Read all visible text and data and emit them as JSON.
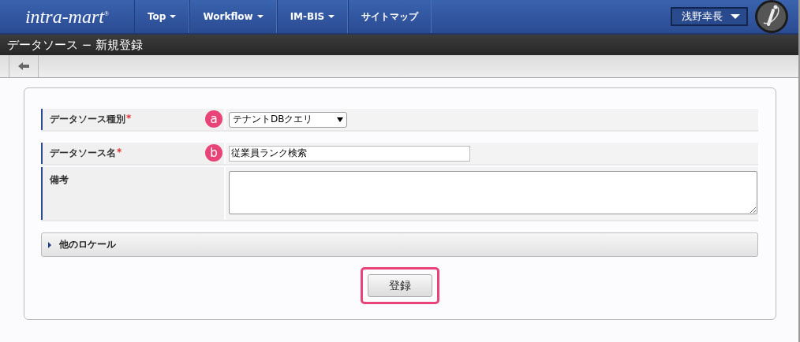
{
  "header": {
    "logo": {
      "text": "intra-mart",
      "mark": "®"
    },
    "menu": [
      {
        "label": "Top",
        "dropdown": true
      },
      {
        "label": "Workflow",
        "dropdown": true
      },
      {
        "label": "IM-BIS",
        "dropdown": true
      },
      {
        "label": "サイトマップ",
        "dropdown": false
      }
    ],
    "user": {
      "name": "浅野幸長"
    }
  },
  "page_title": "データソース − 新規登録",
  "form": {
    "groups": [
      [
        {
          "label": "データソース種別",
          "required": true,
          "annotation": "a",
          "kind": "select",
          "value": "テナントDBクエリ"
        }
      ],
      [
        {
          "label": "データソース名",
          "required": true,
          "annotation": "b",
          "kind": "text",
          "value": "従業員ランク検索"
        },
        {
          "label": "備考",
          "required": false,
          "kind": "textarea"
        }
      ]
    ],
    "required_mark": "*",
    "accordion": {
      "label": "他のロケール",
      "expanded": false
    },
    "submit": {
      "label": "登録",
      "highlighted": true
    }
  }
}
